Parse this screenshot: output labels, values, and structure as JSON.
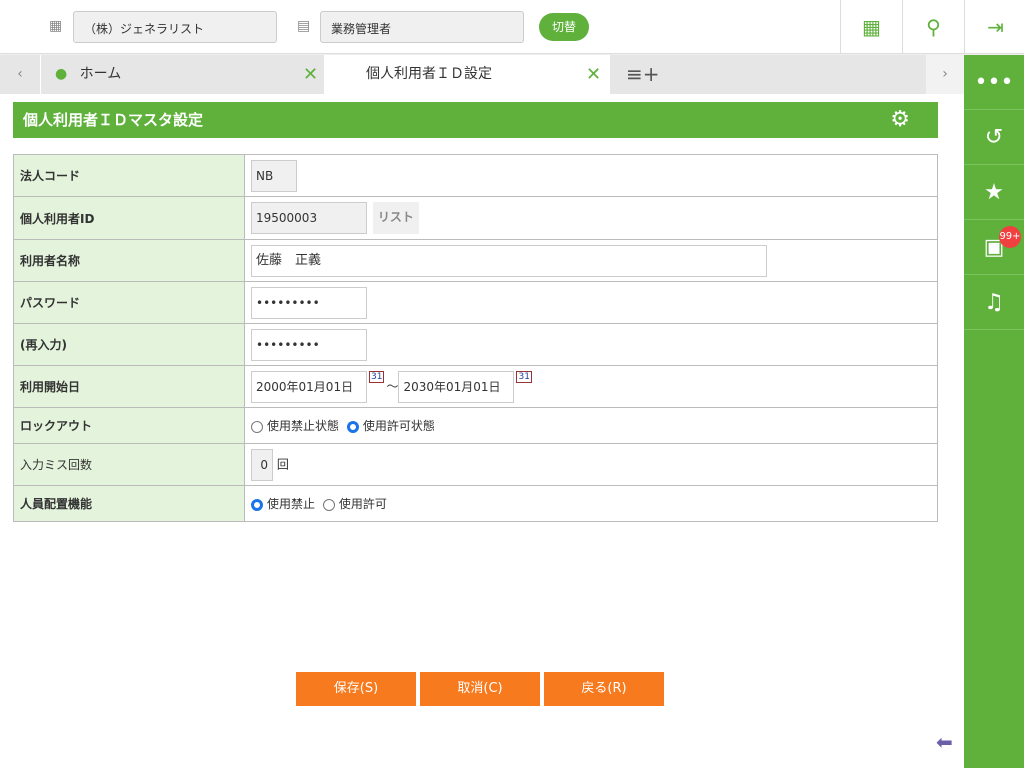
{
  "topbar": {
    "company": "（株）ジェネラリスト",
    "role": "業務管理者",
    "switch_label": "切替"
  },
  "tabs": [
    {
      "label": "ホーム"
    },
    {
      "label": "個人利用者ＩＤ設定"
    }
  ],
  "sidebar": {
    "badge": "99+"
  },
  "page": {
    "title": "個人利用者ＩＤマスタ設定"
  },
  "form": {
    "rows": [
      {
        "label": "法人コード",
        "value": "NB"
      },
      {
        "label": "個人利用者ID",
        "value": "19500003",
        "button": "リスト"
      },
      {
        "label": "利用者名称",
        "value": "佐藤　正義"
      },
      {
        "label": "パスワード",
        "value": "•••••••••"
      },
      {
        "label": "(再入力)",
        "value": "•••••••••"
      },
      {
        "label": "利用開始日",
        "from": "2000年01月01日",
        "sep": "～",
        "to": "2030年01月01日"
      },
      {
        "label": "ロックアウト",
        "options": [
          "使用禁止状態",
          "使用許可状態"
        ],
        "selected": 1
      },
      {
        "label": "入力ミス回数",
        "value": "0",
        "unit": "回"
      },
      {
        "label": "人員配置機能",
        "options": [
          "使用禁止",
          "使用許可"
        ],
        "selected": 0
      }
    ]
  },
  "buttons": {
    "save": "保存(S)",
    "cancel": "取消(C)",
    "back": "戻る(R)"
  }
}
